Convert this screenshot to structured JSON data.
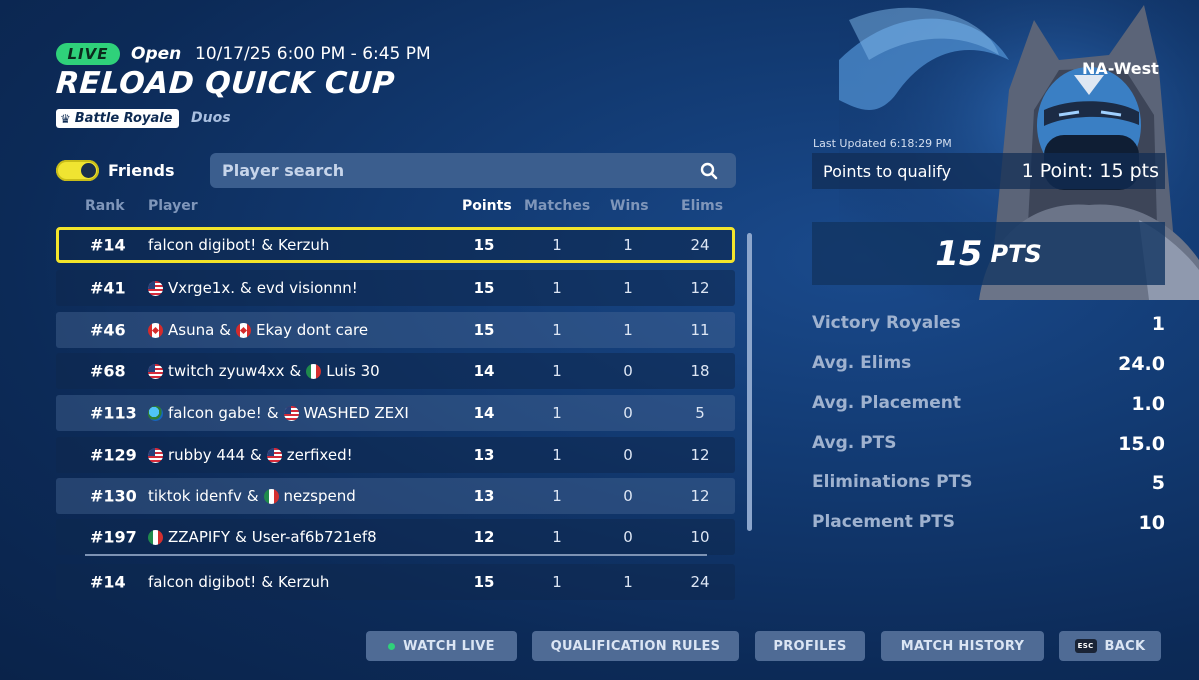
{
  "header": {
    "live_badge": "LIVE",
    "status": "Open",
    "time_range": "10/17/25 6:00 PM - 6:45 PM",
    "title": "RELOAD QUICK CUP",
    "mode": "Battle Royale",
    "mode_icon": "crown-icon",
    "team_size": "Duos",
    "region": "NA-West"
  },
  "filters": {
    "friends_label": "Friends",
    "friends_toggle_on": true,
    "search_placeholder": "Player search",
    "search_icon": "search-icon"
  },
  "table": {
    "columns": {
      "rank": "Rank",
      "player": "Player",
      "points": "Points",
      "matches": "Matches",
      "wins": "Wins",
      "elims": "Elims"
    },
    "rows": [
      {
        "rank": "#14",
        "p1_flag": "",
        "p1": "falcon digibot!",
        "sep": "&",
        "p2_flag": "",
        "p2": "Kerzuh",
        "points": "15",
        "matches": "1",
        "wins": "1",
        "elims": "24"
      },
      {
        "rank": "#41",
        "p1_flag": "us",
        "p1": "Vxrge1x.",
        "sep": "&",
        "p2_flag": "",
        "p2": "evd visionnn!",
        "points": "15",
        "matches": "1",
        "wins": "1",
        "elims": "12"
      },
      {
        "rank": "#46",
        "p1_flag": "ca",
        "p1": "Asuna",
        "sep": "&",
        "p2_flag": "ca",
        "p2": "Ekay dont care",
        "points": "15",
        "matches": "1",
        "wins": "1",
        "elims": "11"
      },
      {
        "rank": "#68",
        "p1_flag": "us",
        "p1": "twitch zyuw4xx",
        "sep": "&",
        "p2_flag": "mx",
        "p2": "Luis 30",
        "points": "14",
        "matches": "1",
        "wins": "0",
        "elims": "18"
      },
      {
        "rank": "#113",
        "p1_flag": "world",
        "p1": "falcon gabe!",
        "sep": "&",
        "p2_flag": "us",
        "p2": "WASHED ZEXI",
        "points": "14",
        "matches": "1",
        "wins": "0",
        "elims": "5"
      },
      {
        "rank": "#129",
        "p1_flag": "us",
        "p1": "rubby 444",
        "sep": "&",
        "p2_flag": "us",
        "p2": "zerfixed!",
        "points": "13",
        "matches": "1",
        "wins": "0",
        "elims": "12"
      },
      {
        "rank": "#130",
        "p1_flag": "",
        "p1": "tiktok idenfv",
        "sep": "&",
        "p2_flag": "mx",
        "p2": "nezspend",
        "points": "13",
        "matches": "1",
        "wins": "0",
        "elims": "12"
      },
      {
        "rank": "#197",
        "p1_flag": "mx",
        "p1": "ZZAPIFY",
        "sep": "&",
        "p2_flag": "",
        "p2": "User-af6b721ef8",
        "points": "12",
        "matches": "1",
        "wins": "0",
        "elims": "10"
      }
    ],
    "pinned_row": {
      "rank": "#14",
      "p1_flag": "",
      "p1": "falcon digibot!",
      "sep": "&",
      "p2_flag": "",
      "p2": "Kerzuh",
      "points": "15",
      "matches": "1",
      "wins": "1",
      "elims": "24"
    }
  },
  "summary": {
    "last_updated": "Last Updated 6:18:29 PM",
    "qualify_label": "Points to qualify",
    "qualify_value": "1 Point: 15 pts",
    "total_points": "15",
    "total_points_unit": "PTS",
    "stats": [
      {
        "label": "Victory Royales",
        "value": "1"
      },
      {
        "label": "Avg. Elims",
        "value": "24.0"
      },
      {
        "label": "Avg. Placement",
        "value": "1.0"
      },
      {
        "label": "Avg. PTS",
        "value": "15.0"
      },
      {
        "label": "Eliminations PTS",
        "value": "5"
      },
      {
        "label": "Placement PTS",
        "value": "10"
      }
    ]
  },
  "buttons": {
    "watch_live": "WATCH LIVE",
    "qualification_rules": "QUALIFICATION RULES",
    "profiles": "PROFILES",
    "match_history": "MATCH HISTORY",
    "back_key": "ESC",
    "back": "BACK"
  },
  "colors": {
    "live": "#2fd17a",
    "highlight": "#f3e52c",
    "toggle_on": "#f0e431",
    "button": "#4f6b95"
  }
}
